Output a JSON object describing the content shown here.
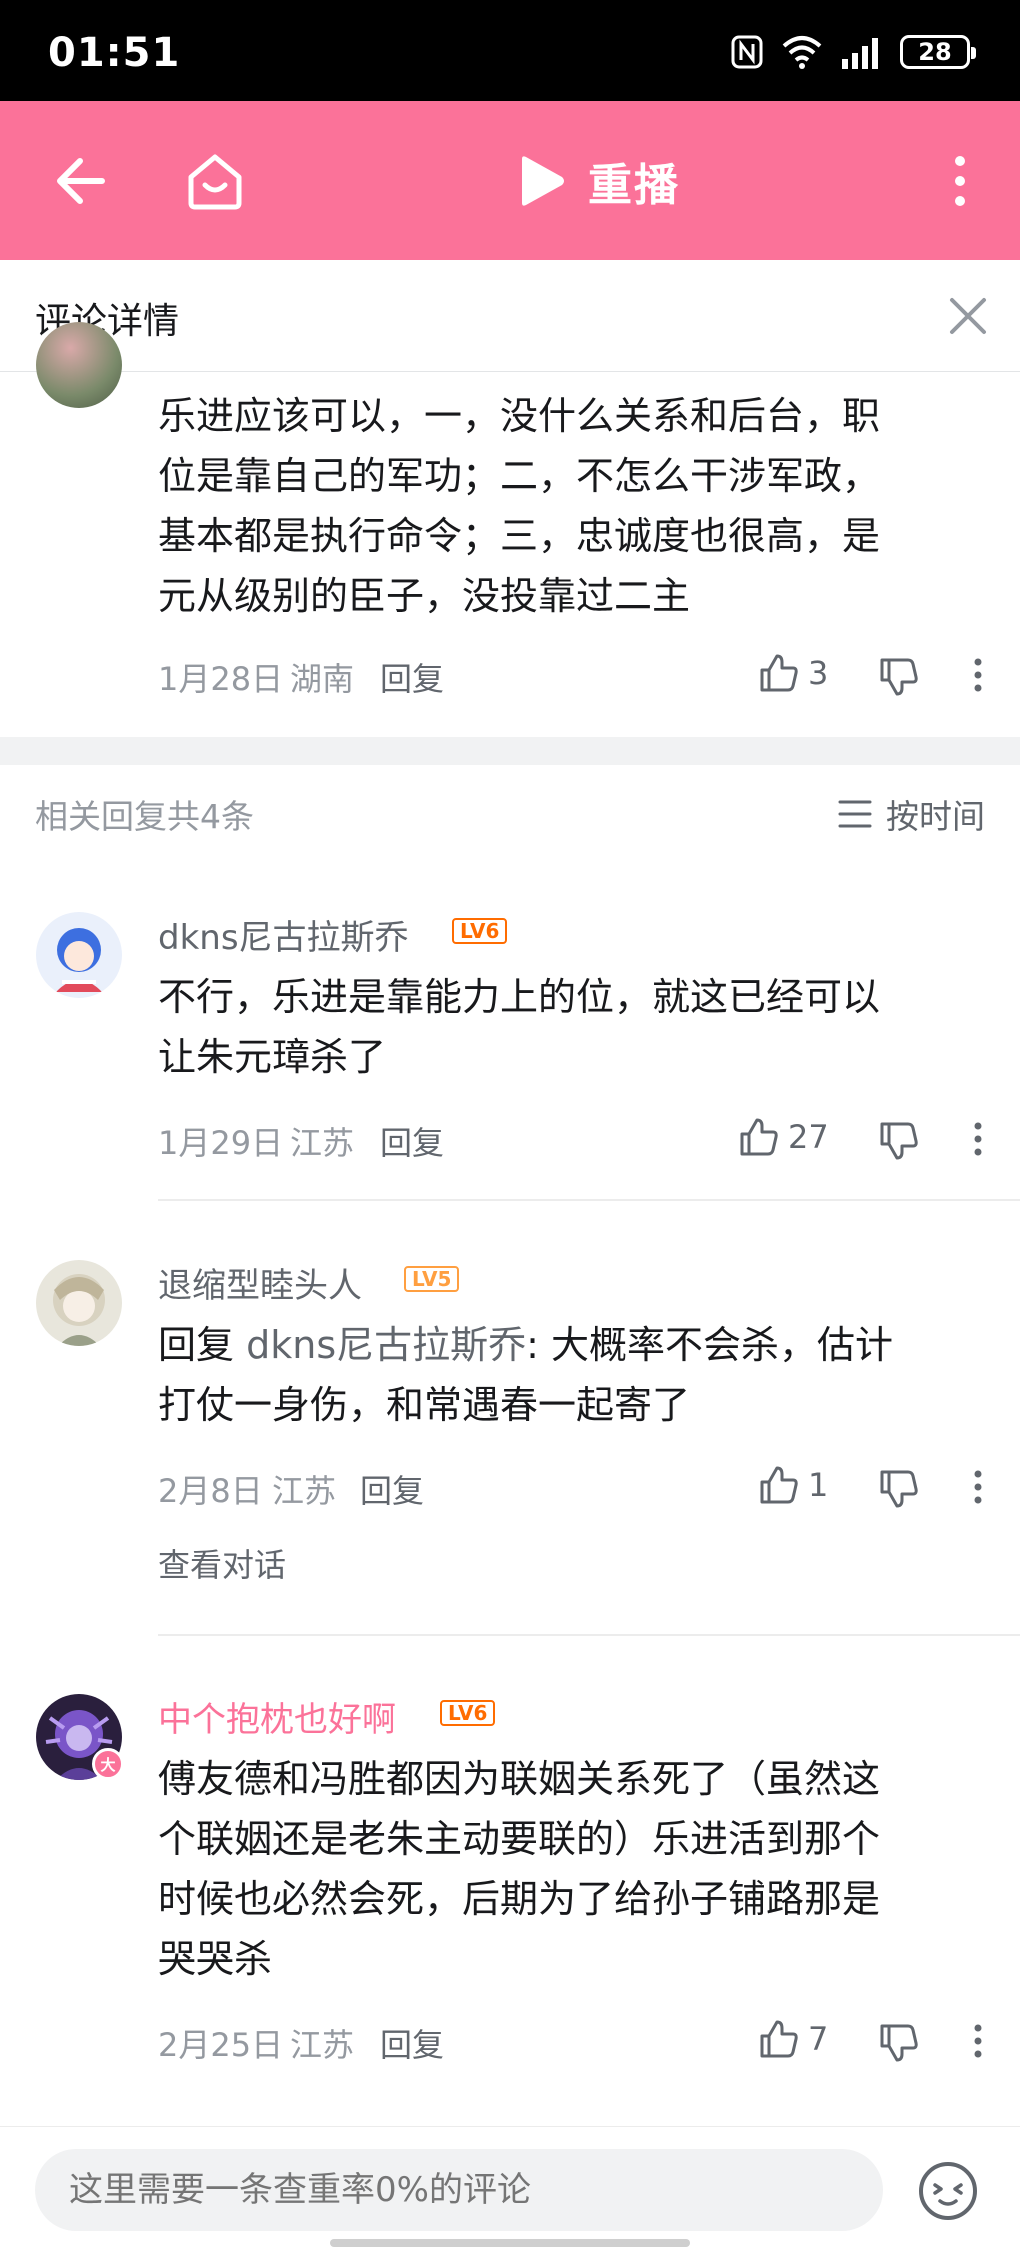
{
  "status_bar": {
    "time": "01:51",
    "battery": "28"
  },
  "header": {
    "replay_label": "重播"
  },
  "title_bar": {
    "title": "评论详情"
  },
  "main_comment": {
    "lines": [
      "乐进应该可以，一，没什么关系和后台，职",
      "位是靠自己的军功；二，不怎么干涉军政，",
      "基本都是执行命令；三，忠诚度也很高，是",
      "元从级别的臣子，没投靠过二主"
    ],
    "date": "1月28日",
    "location": "湖南",
    "reply_label": "回复",
    "like_count": "3"
  },
  "replies_header": {
    "title": "相关回复共4条",
    "sort_label": "按时间"
  },
  "replies": [
    {
      "username": "dkns尼古拉斯乔",
      "level": "LV6",
      "lines": [
        "不行，乐进是靠能力上的位，就这已经可以",
        "让朱元璋杀了"
      ],
      "date": "1月29日",
      "location": "江苏",
      "reply_label": "回复",
      "like_count": "27"
    },
    {
      "username": "退缩型睦头人",
      "level": "LV5",
      "reply_prefix": "回复",
      "reply_target": "dkns尼古拉斯乔",
      "lines": [
        ": 大概率不会杀，估计",
        "打仗一身伤，和常遇春一起寄了"
      ],
      "date": "2月8日",
      "location": "江苏",
      "reply_label": "回复",
      "like_count": "1",
      "view_conversation": "查看对话"
    },
    {
      "username": "中个抱枕也好啊",
      "level": "LV6",
      "badge": "大",
      "lines": [
        "傅友德和冯胜都因为联姻关系死了（虽然这",
        "个联姻还是老朱主动要联的）乐进活到那个",
        "时候也必然会死，后期为了给孙子铺路那是",
        "哭哭杀"
      ],
      "date": "2月25日",
      "location": "江苏",
      "reply_label": "回复",
      "like_count": "7"
    }
  ],
  "input_bar": {
    "placeholder": "这里需要一条查重率0%的评论"
  },
  "colors": {
    "brand_pink": "#fb7299",
    "lv6": "#ff6c00",
    "lv5": "#ff9f40",
    "vip_name": "#fb7299"
  }
}
